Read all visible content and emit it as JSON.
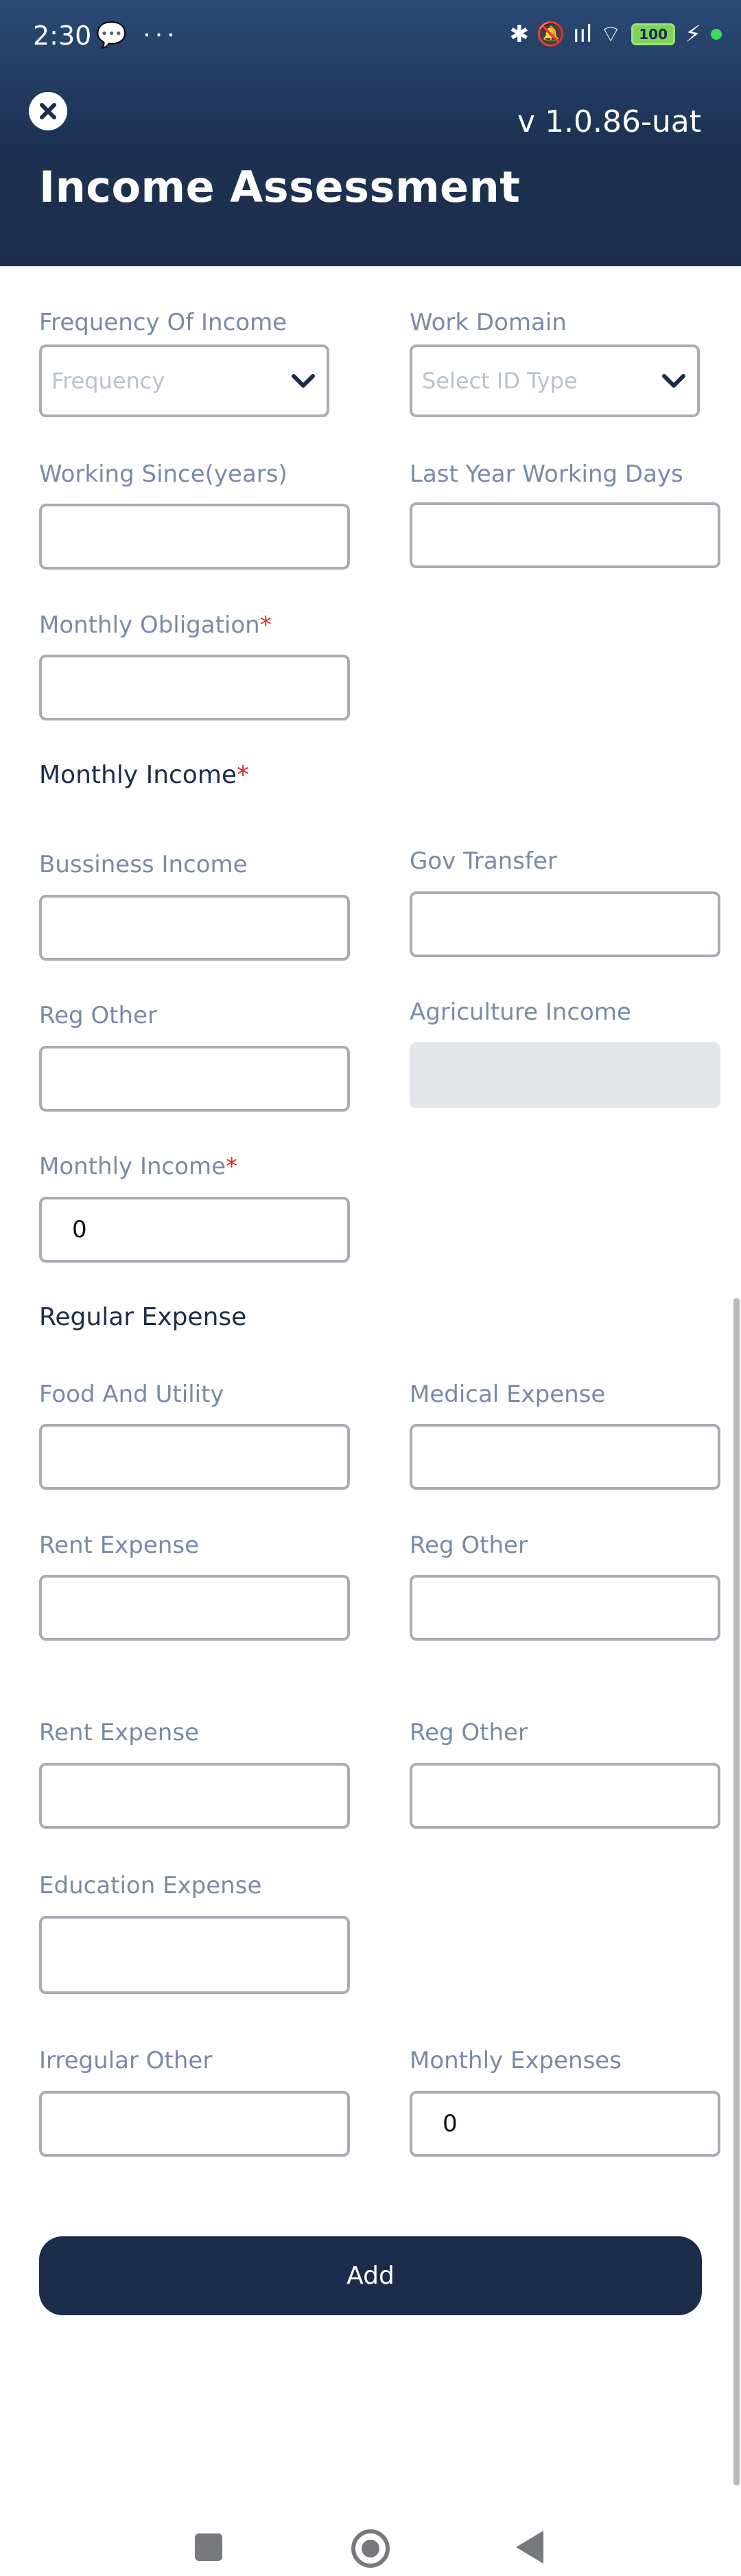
{
  "status_bar": {
    "time": "2:30",
    "left_icons": "💬 ···",
    "signal_icons": "✱ 🔕 ııl ⌔",
    "battery": "100"
  },
  "header": {
    "version": "v 1.0.86-uat",
    "title": "Income Assessment"
  },
  "form": {
    "frequency_label": "Frequency Of Income",
    "frequency_placeholder": "Frequency",
    "work_domain_label": "Work Domain",
    "work_domain_placeholder": "Select ID Type",
    "working_since_label": "Working Since(years)",
    "last_year_days_label": "Last Year Working Days",
    "monthly_obligation_label": "Monthly Obligation",
    "monthly_income_section": "Monthly Income",
    "business_income_label": "Bussiness Income",
    "gov_transfer_label": "Gov Transfer",
    "reg_other_label": "Reg Other",
    "agriculture_income_label": "Agriculture Income",
    "monthly_income_label": "Monthly Income",
    "monthly_income_value": "0",
    "regular_expense_section": "Regular Expense",
    "food_utility_label": "Food And Utility",
    "medical_expense_label": "Medical Expense",
    "rent_expense_label": "Rent Expense",
    "reg_other_expense_label": "Reg Other",
    "rent_expense_label_2": "Rent Expense",
    "reg_other_expense_label_2": "Reg Other",
    "education_expense_label": "Education Expense",
    "irregular_other_label": "Irregular Other",
    "monthly_expenses_label": "Monthly Expenses",
    "monthly_expenses_value": "0",
    "required_mark": "*"
  },
  "actions": {
    "add_label": "Add"
  }
}
